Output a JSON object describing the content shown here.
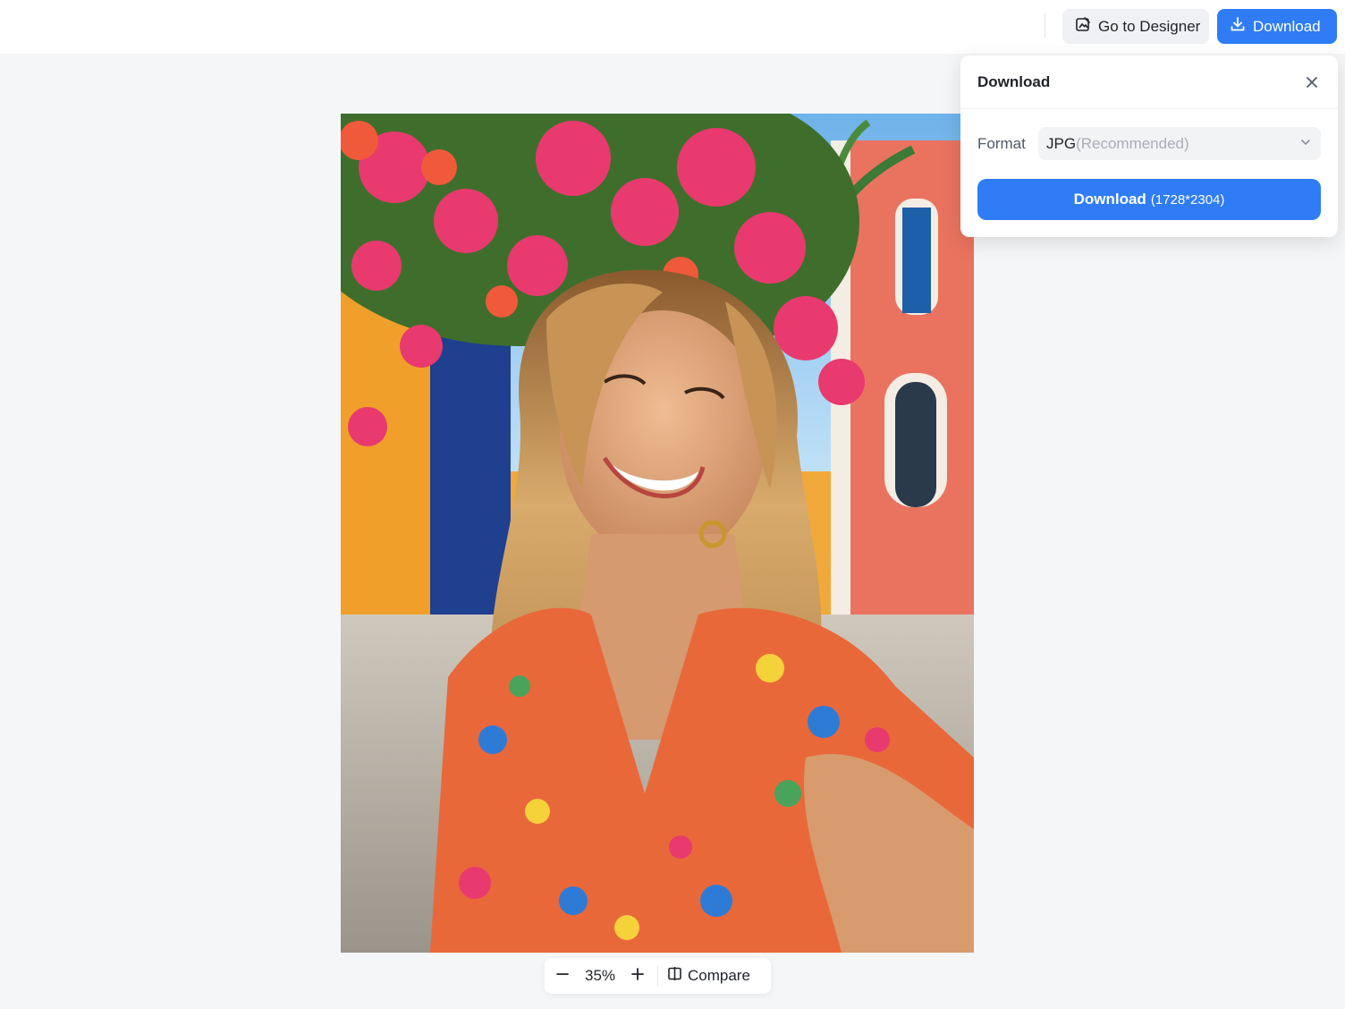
{
  "header": {
    "go_to_designer_label": "Go to Designer",
    "download_label": "Download"
  },
  "download_panel": {
    "title": "Download",
    "format_label": "Format",
    "format_value": "JPG",
    "format_hint": "(Recommended)",
    "download_button_label": "Download",
    "download_dimensions": "(1728*2304)"
  },
  "zoom_toolbar": {
    "zoom_value": "35%",
    "compare_label": "Compare"
  },
  "colors": {
    "accent": "#2f7cf6",
    "background": "#f5f6f8"
  },
  "icons": {
    "designer": "edit-image-icon",
    "download": "download-icon",
    "close": "close-icon",
    "dropdown": "chevron-down-icon",
    "zoom_out": "minus-icon",
    "zoom_in": "plus-icon",
    "compare": "compare-icon"
  }
}
